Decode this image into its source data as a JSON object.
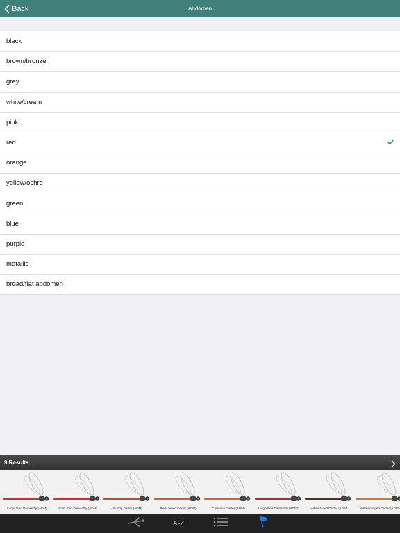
{
  "navbar": {
    "back_label": "Back",
    "title": "Abdomen"
  },
  "options": [
    {
      "label": "black",
      "selected": false
    },
    {
      "label": "brown/bronze",
      "selected": false
    },
    {
      "label": "grey",
      "selected": false
    },
    {
      "label": "white/cream",
      "selected": false
    },
    {
      "label": "pink",
      "selected": false
    },
    {
      "label": "red",
      "selected": true
    },
    {
      "label": "orange",
      "selected": false
    },
    {
      "label": "yellow/ochre",
      "selected": false
    },
    {
      "label": "green",
      "selected": false
    },
    {
      "label": "blue",
      "selected": false
    },
    {
      "label": "purple",
      "selected": false
    },
    {
      "label": "metallic",
      "selected": false
    },
    {
      "label": "broad/flat abdomen",
      "selected": false
    }
  ],
  "results": {
    "label": "9 Results",
    "items": [
      {
        "name": "Large Red Damselfly (ADM)",
        "body_color": "#c0392b"
      },
      {
        "name": "Small Red Damselfly (ADM)",
        "body_color": "#d02a2a"
      },
      {
        "name": "Ruddy Darter (ADM)",
        "body_color": "#b9521d"
      },
      {
        "name": "Red-veined Darter (ADM)",
        "body_color": "#c4602a"
      },
      {
        "name": "Common Darter (ADM)",
        "body_color": "#c8672c"
      },
      {
        "name": "Large Red Damselfly (ADFT)",
        "body_color": "#a93226"
      },
      {
        "name": "White-faced Darter (ADM)",
        "body_color": "#5a2a1e"
      },
      {
        "name": "Yellow-winged Darter (ADM)",
        "body_color": "#d07a2c"
      }
    ]
  },
  "tabbar": {
    "az_label": "A-Z"
  },
  "colors": {
    "navbar": "#3f817a",
    "accent": "#1a7ae0",
    "check": "#1a7ae0",
    "tabbar": "#222222"
  },
  "icons": {
    "back": "chevron-left-icon",
    "check": "checkmark-icon",
    "results": "chevron-right-icon",
    "tab1": "dragonfly-icon",
    "tab3": "list-icon",
    "tab4": "flag-icon"
  }
}
